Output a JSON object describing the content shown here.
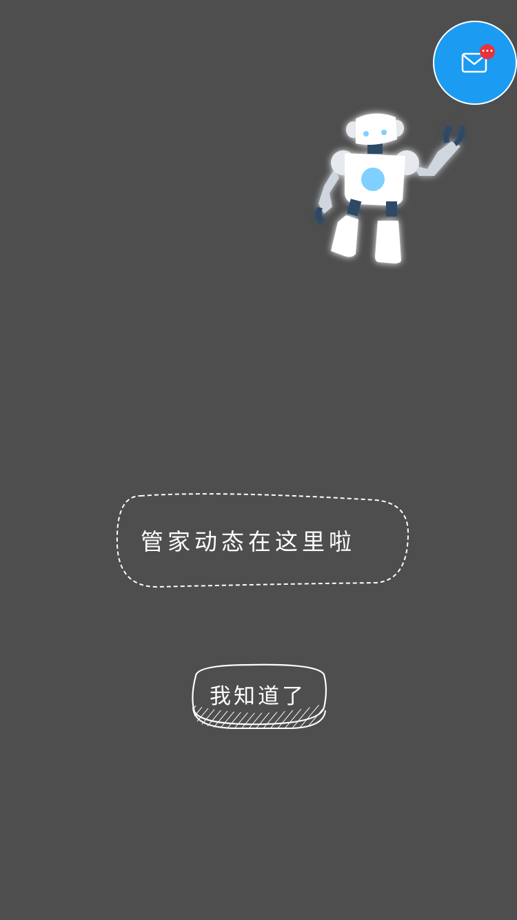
{
  "guide": {
    "tip_text": "管家动态在这里啦",
    "confirm_label": "我知道了"
  },
  "message_button": {
    "icon": "mail-icon",
    "badge": "•••"
  },
  "colors": {
    "overlay": "#4e4e4e",
    "accent_blue": "#1c9bf2",
    "badge_red": "#e8333b",
    "text": "#ffffff"
  }
}
